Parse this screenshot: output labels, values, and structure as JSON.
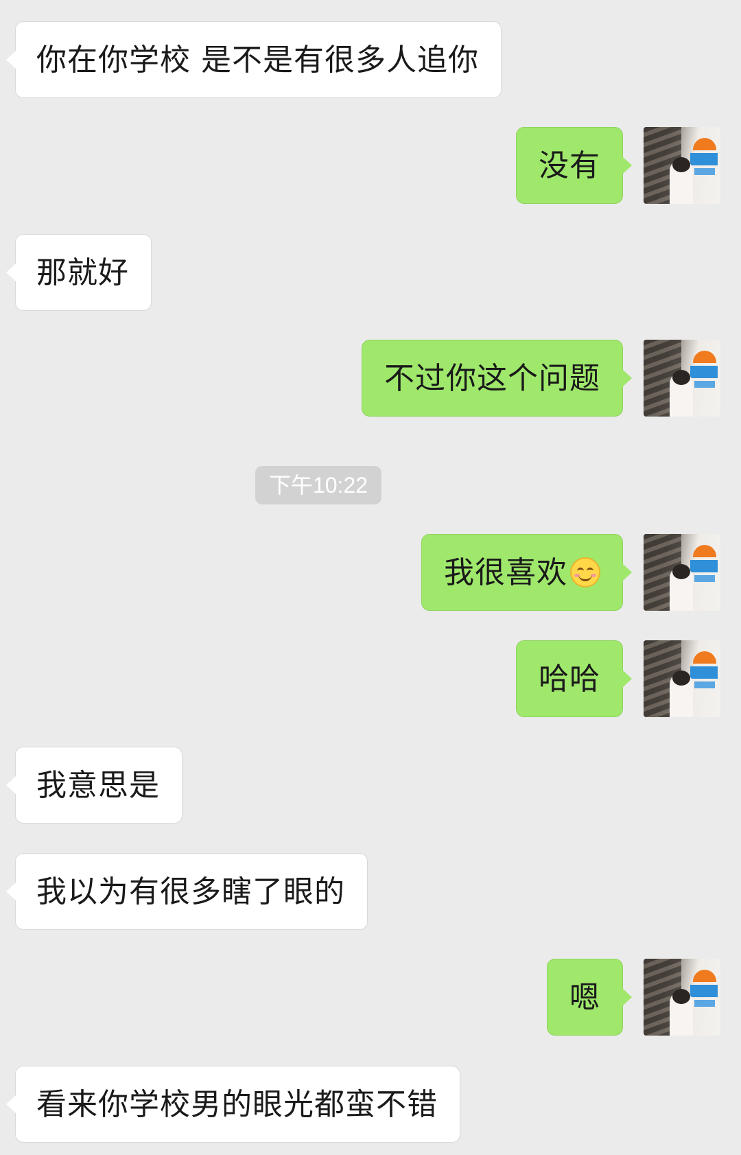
{
  "conversation": {
    "timestamp": "下午10:22",
    "messages": [
      {
        "side": "in",
        "text": "你在你学校 是不是有很多人追你"
      },
      {
        "side": "out",
        "text": "没有"
      },
      {
        "side": "in",
        "text": "那就好"
      },
      {
        "side": "out",
        "text": "不过你这个问题"
      },
      {
        "side": "out",
        "text": "我很喜欢",
        "emoji": "smile-emoji"
      },
      {
        "side": "out",
        "text": "哈哈"
      },
      {
        "side": "in",
        "text": "我意思是"
      },
      {
        "side": "in",
        "text": "我以为有很多瞎了眼的"
      },
      {
        "side": "out",
        "text": "嗯"
      },
      {
        "side": "in",
        "text": "看来你学校男的眼光都蛮不错"
      }
    ]
  },
  "colors": {
    "background": "#ebebeb",
    "incoming_bubble": "#ffffff",
    "outgoing_bubble": "#9fe86c",
    "timestamp_pill": "#d2d2d2"
  },
  "icons": {
    "avatar": "user-avatar-photo",
    "emoji": "smile-emoji"
  }
}
